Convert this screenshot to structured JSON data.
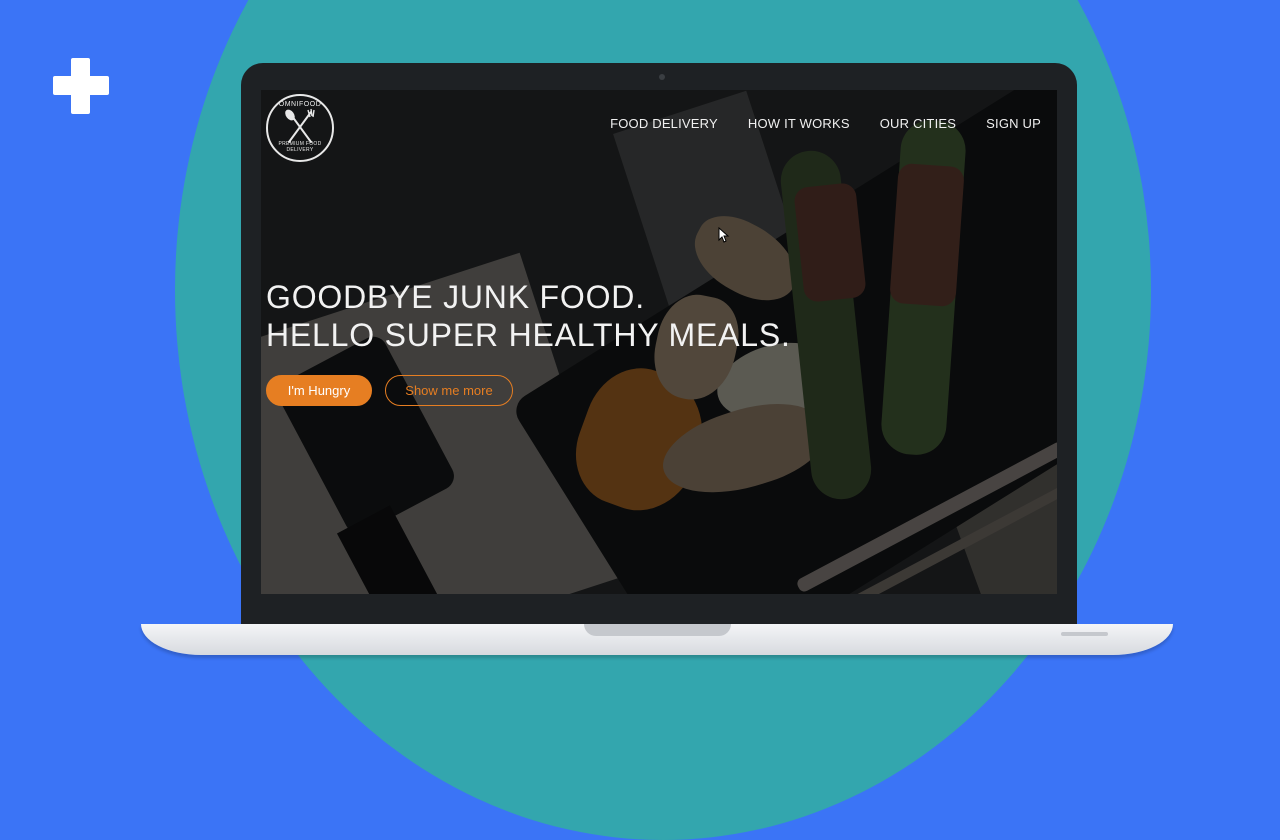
{
  "site": {
    "logo_top_text": "OMNIFOOD",
    "logo_bottom_text": "PREMIUM FOOD DELIVERY"
  },
  "nav": {
    "items": [
      {
        "label": "FOOD DELIVERY"
      },
      {
        "label": "HOW IT WORKS"
      },
      {
        "label": "OUR CITIES"
      },
      {
        "label": "SIGN UP"
      }
    ]
  },
  "hero": {
    "line1": "GOODBYE JUNK FOOD.",
    "line2": "HELLO SUPER HEALTHY MEALS.",
    "primary_button": "I'm Hungry",
    "secondary_button": "Show me more"
  },
  "colors": {
    "accent": "#e67e22",
    "background": "#3b74f6",
    "circle": "#33a6ae"
  },
  "icons": [
    "plus-icon",
    "cutlery-icon",
    "cursor-icon"
  ]
}
